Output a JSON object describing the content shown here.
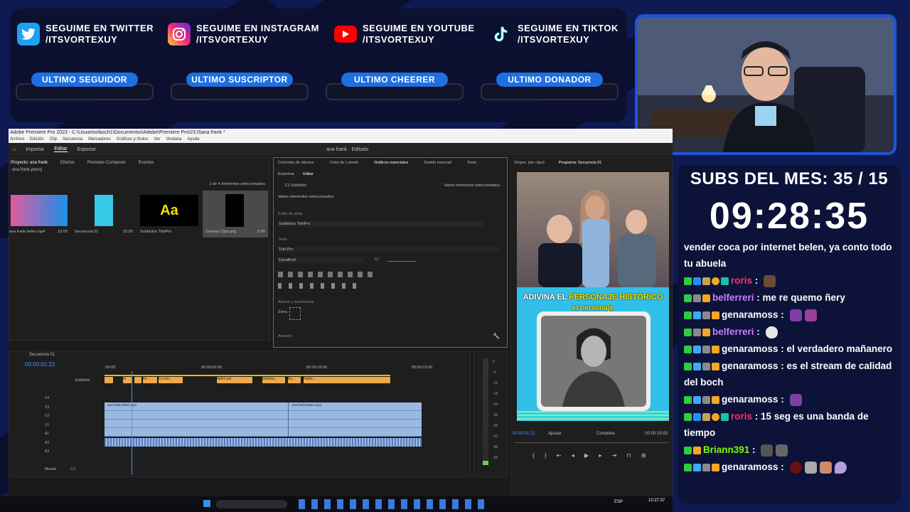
{
  "social": [
    {
      "line1": "SEGUIME EN TWITTER",
      "line2": "/ITSVORTEXUY",
      "icon": "twitter-icon",
      "color": "#1da1f2"
    },
    {
      "line1": "SEGUIME EN INSTAGRAM",
      "line2": "/ITSVORTEXUY",
      "icon": "instagram-icon",
      "color": "#d6249f"
    },
    {
      "line1": "SEGUIME EN YOUTUBE",
      "line2": "/ITSVORTEXUY",
      "icon": "youtube-icon",
      "color": "#ff0000"
    },
    {
      "line1": "SEGUIME EN TIKTOK",
      "line2": "/ITSVORTEXUY",
      "icon": "tiktok-icon",
      "color": "#ffffff"
    }
  ],
  "alerts": [
    "ULTIMO SEGUIDOR",
    "ULTIMO SUSCRIPTOR",
    "ULTIMO CHEERER",
    "ULTIMO DONADOR"
  ],
  "subs_goal": "SUBS DEL MES: 35 / 15",
  "countdown": "09:28:35",
  "chat": [
    {
      "user": "",
      "text": "vender coca por internet belen, ya conto todo tu abuela",
      "color": "#ffffff"
    },
    {
      "user": "roris",
      "text": "",
      "color": "#ff2f6d"
    },
    {
      "user": "belferreri",
      "text": "me re quemo ñery",
      "color": "#c77dff"
    },
    {
      "user": "genaramoss",
      "text": "",
      "color": "#ffffff"
    },
    {
      "user": "belferreri",
      "text": "",
      "color": "#c77dff"
    },
    {
      "user": "genaramoss",
      "text": "el verdadero mañanero",
      "color": "#ffffff"
    },
    {
      "user": "genaramoss",
      "text": "es el stream de calidad del boch",
      "color": "#ffffff"
    },
    {
      "user": "genaramoss",
      "text": "",
      "color": "#ffffff"
    },
    {
      "user": "roris",
      "text": "15 seg es una banda de tiempo",
      "color": "#ff2f6d"
    },
    {
      "user": "Briann391",
      "text": "",
      "color": "#7cfc00"
    },
    {
      "user": "genaramoss",
      "text": "",
      "color": "#ffffff"
    }
  ],
  "premiere": {
    "title": "Adobe Premiere Pro 2023 - C:\\Usuarios\\boch1\\Documentos\\Adobe\\Premiere Pro\\23.0\\ana frank *",
    "menu": [
      "Archivo",
      "Edición",
      "Clip",
      "Secuencia",
      "Marcadores",
      "Gráficos y títulos",
      "Ver",
      "Ventana",
      "Ayuda"
    ],
    "workspace": [
      "Importar",
      "Editar",
      "Exportar"
    ],
    "center_title": "ana frank · Editado",
    "project_tabs": [
      "Proyecto: ana frank",
      "Efectos",
      "Premiere Composer",
      "Eventos"
    ],
    "project_file": "ana frank.prproj",
    "selected_count": "1 de 4 elementos seleccionados",
    "bins": [
      {
        "name": "ana frank belen.mp4",
        "dur": "10:00"
      },
      {
        "name": "Secuencia 01",
        "dur": "15:00"
      },
      {
        "name": "Subtitulos TobiPro",
        "dur": "",
        "glyph": "Aa"
      },
      {
        "name": "Overlay Clips.png",
        "dur": "5:00"
      }
    ],
    "egp_tabs": [
      "Controles de efectos",
      "Color de Lumetri",
      "Gráficos esenciales",
      "Sonido esencial",
      "Texto"
    ],
    "egp_sub": [
      "Examinar",
      "Editar"
    ],
    "egp": {
      "layer": "C1:Subtítulo",
      "varios": "Varios elementos seleccionados",
      "varios2": "Varios elementos seleccionados",
      "track_style_label": "Estilo de pista",
      "track_style": "Subtitulos TobiPro",
      "text_label": "Texto",
      "font": "Tobi Pro",
      "weight": "ExtraBold",
      "size": "62",
      "align_label": "Alinear y transformar",
      "zone": "Zona",
      "aspect": "Aspecto"
    },
    "src_tabs": [
      "Origen: (sin clips)",
      "Programa: Secuencia 01"
    ],
    "program": {
      "banner1": "ADIVINA EL",
      "banner1b": "PERSONAJE HISTÓRICO",
      "banner2": "el personaje",
      "tc_left": "00:00:01:22",
      "fit": "Ajustar",
      "quality": "Completa",
      "tc_right": "00:00:15:00"
    },
    "timeline": {
      "seq": "Secuencia 01",
      "tc": "00:00:01:22",
      "ruler": [
        ":00:00",
        "00:00:05:00",
        "00:00:10:00",
        "00:00:15:00"
      ],
      "sub_label": "Subtítulo",
      "sub_clips": [
        "",
        "el",
        "",
        "fol...",
        "Lo con...",
        "belen por",
        "primera...",
        "Es...",
        "Kahlo..."
      ],
      "video_clips": [
        "ana frank belen.mp4",
        "ana frank belen.mp4"
      ],
      "tracks": [
        "V4",
        "V3",
        "V2",
        "V1",
        "A1",
        "A2",
        "A3"
      ],
      "mix": "Mezcla",
      "mix_val": "0,0"
    },
    "meter": [
      "0",
      "-6",
      "-12",
      "-18",
      "-24",
      "-30",
      "-36",
      "-42",
      "-48",
      "-54"
    ],
    "clock": "10:27:37",
    "lang": "ESP"
  }
}
